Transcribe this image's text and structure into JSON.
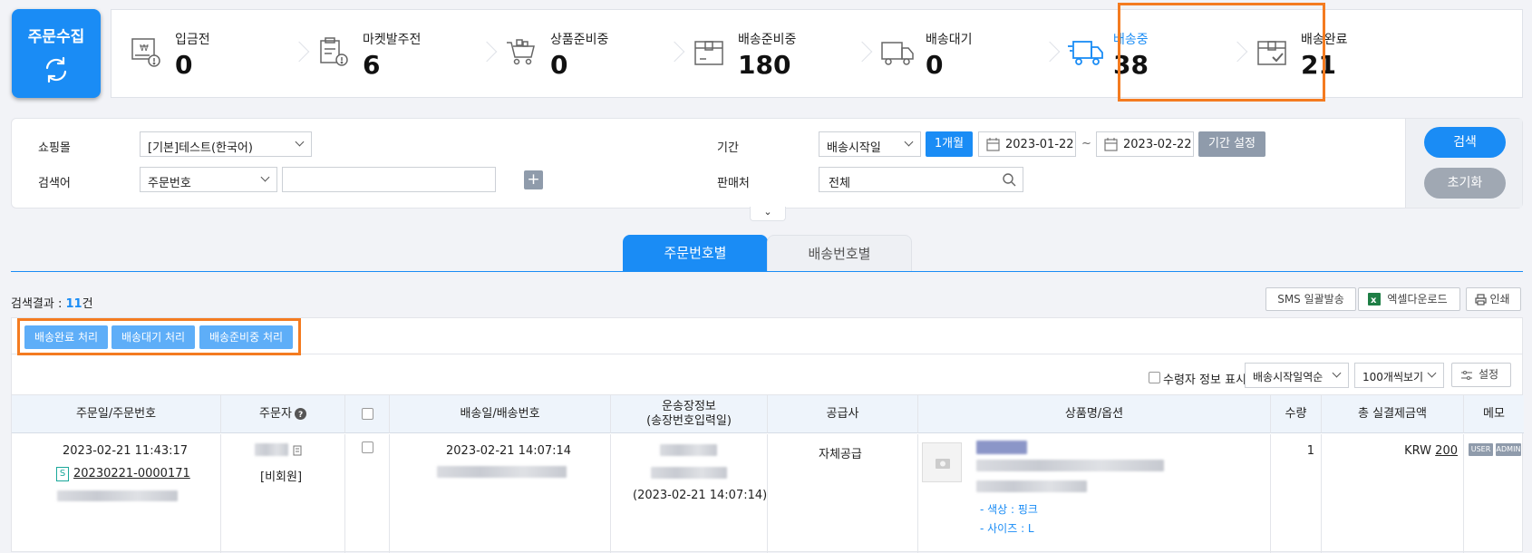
{
  "collect_button": {
    "label": "주문수집"
  },
  "stages": [
    {
      "name": "입금전",
      "count": "0",
      "icon": "payment-pending-icon"
    },
    {
      "name": "마켓발주전",
      "count": "6",
      "icon": "market-order-icon"
    },
    {
      "name": "상품준비중",
      "count": "0",
      "icon": "cart-icon"
    },
    {
      "name": "배송준비중",
      "count": "180",
      "icon": "box-icon"
    },
    {
      "name": "배송대기",
      "count": "0",
      "icon": "truck-wait-icon"
    },
    {
      "name": "배송중",
      "count": "38",
      "icon": "truck-moving-icon",
      "active": true
    },
    {
      "name": "배송완료",
      "count": "21",
      "icon": "box-check-icon"
    }
  ],
  "filter": {
    "shop_label": "쇼핑몰",
    "shop_value": "[기본]테스트(한국어)",
    "search_label": "검색어",
    "search_type": "주문번호",
    "search_value": "",
    "period_label": "기간",
    "period_type": "배송시작일",
    "period_quick": "1개월",
    "date_from": "2023-01-22",
    "date_sep": "~",
    "date_to": "2023-02-22",
    "period_set": "기간 설정",
    "seller_label": "판매처",
    "seller_value": "전체",
    "search_btn": "검색",
    "reset_btn": "초기화"
  },
  "tabs": [
    {
      "label": "주문번호별",
      "active": true
    },
    {
      "label": "배송번호별",
      "active": false
    }
  ],
  "result": {
    "prefix": "검색결과 : ",
    "count": "11",
    "suffix": "건"
  },
  "tools": {
    "sms": "SMS 일괄발송",
    "excel": "엑셀다운로드",
    "print": "인쇄"
  },
  "actions": [
    "배송완료 처리",
    "배송대기 처리",
    "배송준비중 처리"
  ],
  "options": {
    "receiver_info": "수령자 정보 표시",
    "sort": "배송시작일역순",
    "per_page": "100개씩보기",
    "settings": "설정"
  },
  "columns": [
    "주문일/주문번호",
    "주문자",
    "",
    "배송일/배송번호",
    "운송장정보\n(송장번호입력일)",
    "공급사",
    "상품명/옵션",
    "수량",
    "총 실결제금액",
    "메모"
  ],
  "row": {
    "order_datetime": "2023-02-21 11:43:17",
    "order_number": "20230221-0000171",
    "order_badge": "S",
    "orderer_type": "[비회원]",
    "ship_datetime": "2023-02-21 14:07:14",
    "invoice_date": "(2023-02-21 14:07:14)",
    "supplier": "자체공급",
    "option_color": "- 색상 : 핑크",
    "option_size": "- 사이즈 : L",
    "qty": "1",
    "currency": "KRW",
    "amount": "200",
    "memo_user": "USER",
    "memo_admin": "ADMIN"
  },
  "colors": {
    "primary": "#1a8cf5",
    "highlight": "#f47b20",
    "gray_btn": "#8f9bab"
  }
}
